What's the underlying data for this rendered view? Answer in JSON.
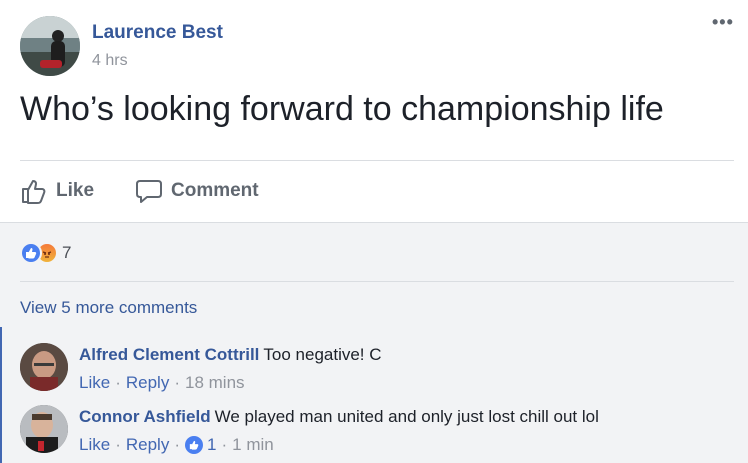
{
  "post": {
    "author": "Laurence Best",
    "time": "4 hrs",
    "more_label": "•••",
    "text": "Who’s looking forward to championship life",
    "actions": {
      "like": "Like",
      "comment": "Comment"
    }
  },
  "reactions": {
    "types": [
      "like-icon",
      "angry-icon"
    ],
    "count": "7"
  },
  "view_more": "View 5 more comments",
  "comments": [
    {
      "author": "Alfred Clement Cottrill",
      "text": "Too negative! C",
      "like": "Like",
      "reply": "Reply",
      "time": "18 mins"
    },
    {
      "author": "Connor Ashfield",
      "text": "We played man united and only just lost chill out lol",
      "like": "Like",
      "reply": "Reply",
      "likes": "1",
      "time": "1 min"
    }
  ],
  "colors": {
    "link": "#365899",
    "action": "#4267b2",
    "muted": "#90949c",
    "like_blue": "#4a7ff0"
  }
}
